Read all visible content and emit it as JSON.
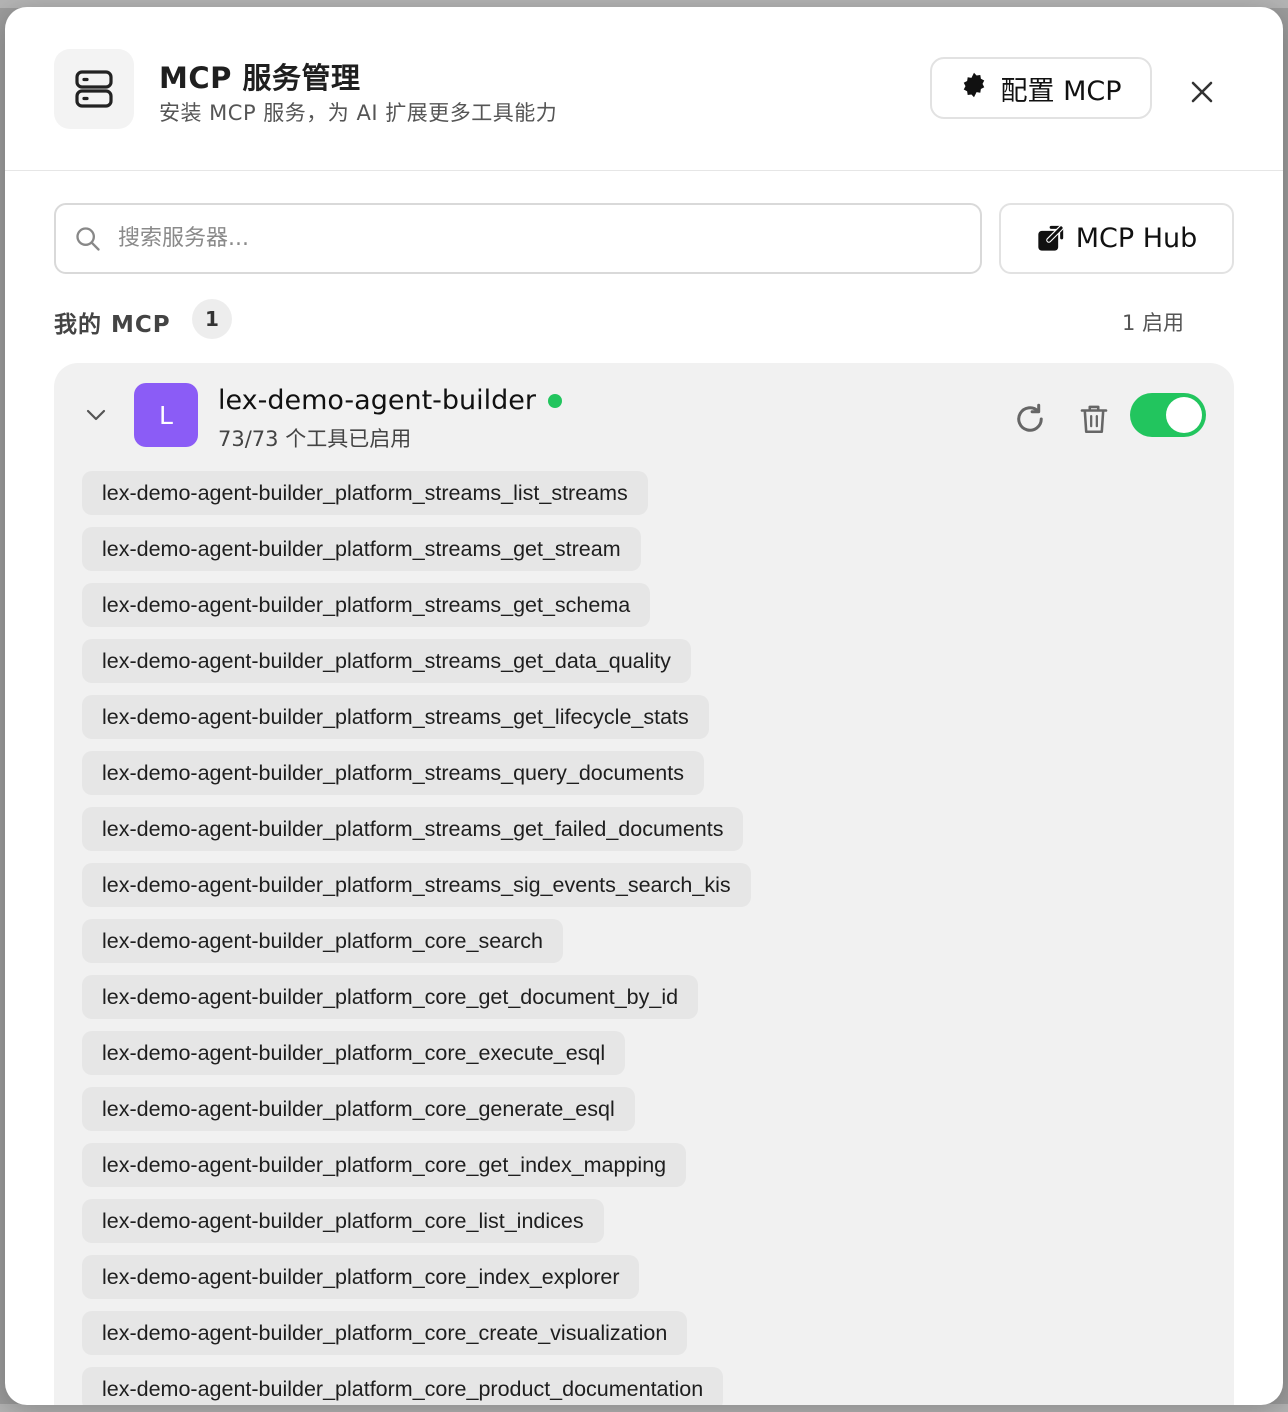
{
  "header": {
    "title": "MCP 服务管理",
    "subtitle": "安装 MCP 服务，为 AI 扩展更多工具能力",
    "config_label": "配置 MCP"
  },
  "search": {
    "placeholder": "搜索服务器..."
  },
  "hub_label": "MCP Hub",
  "section": {
    "label": "我的 MCP",
    "count": "1",
    "enabled": "1 启用"
  },
  "server": {
    "avatar_letter": "L",
    "name": "lex-demo-agent-builder",
    "tools_status": "73/73 个工具已启用",
    "status_color": "#22c55e",
    "enabled": true,
    "tools": [
      "lex-demo-agent-builder_platform_streams_list_streams",
      "lex-demo-agent-builder_platform_streams_get_stream",
      "lex-demo-agent-builder_platform_streams_get_schema",
      "lex-demo-agent-builder_platform_streams_get_data_quality",
      "lex-demo-agent-builder_platform_streams_get_lifecycle_stats",
      "lex-demo-agent-builder_platform_streams_query_documents",
      "lex-demo-agent-builder_platform_streams_get_failed_documents",
      "lex-demo-agent-builder_platform_streams_sig_events_search_kis",
      "lex-demo-agent-builder_platform_core_search",
      "lex-demo-agent-builder_platform_core_get_document_by_id",
      "lex-demo-agent-builder_platform_core_execute_esql",
      "lex-demo-agent-builder_platform_core_generate_esql",
      "lex-demo-agent-builder_platform_core_get_index_mapping",
      "lex-demo-agent-builder_platform_core_list_indices",
      "lex-demo-agent-builder_platform_core_index_explorer",
      "lex-demo-agent-builder_platform_core_create_visualization",
      "lex-demo-agent-builder_platform_core_product_documentation"
    ]
  },
  "colors": {
    "accent_purple": "#8b5cf6",
    "toggle_on": "#22c55e"
  }
}
